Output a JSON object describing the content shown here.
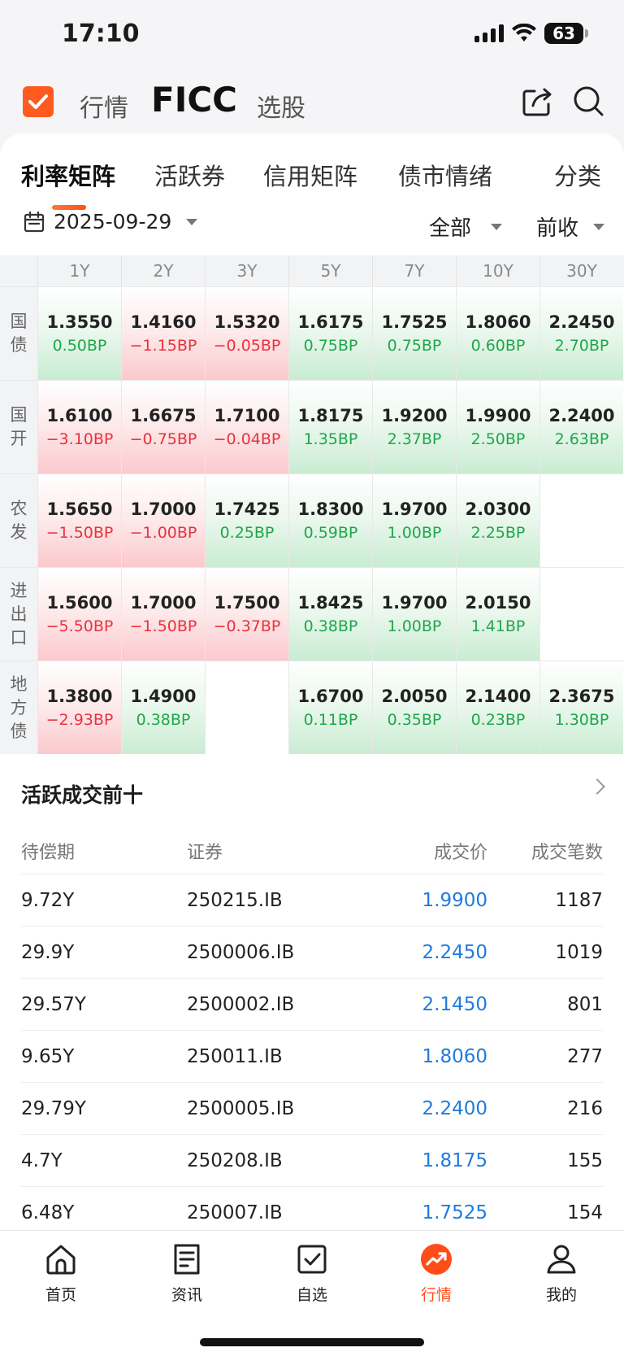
{
  "status": {
    "time": "17:10",
    "battery": "63"
  },
  "header": {
    "tabs": [
      "行情",
      "FICC",
      "选股"
    ],
    "active_tab": "FICC"
  },
  "subtabs": [
    "利率矩阵",
    "活跃券",
    "信用矩阵",
    "债市情绪",
    "分类"
  ],
  "filters": {
    "date": "2025-09-29",
    "scope": "全部",
    "measure": "前收"
  },
  "matrix": {
    "columns": [
      "1Y",
      "2Y",
      "3Y",
      "5Y",
      "7Y",
      "10Y",
      "30Y"
    ],
    "rows": [
      {
        "label": "国债",
        "cells": [
          {
            "v": "1.3550",
            "c": "0.50BP",
            "d": "down"
          },
          {
            "v": "1.4160",
            "c": "−1.15BP",
            "d": "up"
          },
          {
            "v": "1.5320",
            "c": "−0.05BP",
            "d": "up"
          },
          {
            "v": "1.6175",
            "c": "0.75BP",
            "d": "down"
          },
          {
            "v": "1.7525",
            "c": "0.75BP",
            "d": "down"
          },
          {
            "v": "1.8060",
            "c": "0.60BP",
            "d": "down"
          },
          {
            "v": "2.2450",
            "c": "2.70BP",
            "d": "down"
          }
        ]
      },
      {
        "label": "国开",
        "cells": [
          {
            "v": "1.6100",
            "c": "−3.10BP",
            "d": "up"
          },
          {
            "v": "1.6675",
            "c": "−0.75BP",
            "d": "up"
          },
          {
            "v": "1.7100",
            "c": "−0.04BP",
            "d": "up"
          },
          {
            "v": "1.8175",
            "c": "1.35BP",
            "d": "down"
          },
          {
            "v": "1.9200",
            "c": "2.37BP",
            "d": "down"
          },
          {
            "v": "1.9900",
            "c": "2.50BP",
            "d": "down"
          },
          {
            "v": "2.2400",
            "c": "2.63BP",
            "d": "down"
          }
        ]
      },
      {
        "label": "农发",
        "cells": [
          {
            "v": "1.5650",
            "c": "−1.50BP",
            "d": "up"
          },
          {
            "v": "1.7000",
            "c": "−1.00BP",
            "d": "up"
          },
          {
            "v": "1.7425",
            "c": "0.25BP",
            "d": "down"
          },
          {
            "v": "1.8300",
            "c": "0.59BP",
            "d": "down"
          },
          {
            "v": "1.9700",
            "c": "1.00BP",
            "d": "down"
          },
          {
            "v": "2.0300",
            "c": "2.25BP",
            "d": "down"
          },
          {
            "v": "",
            "c": "",
            "d": "empty"
          }
        ]
      },
      {
        "label": "进出口",
        "cells": [
          {
            "v": "1.5600",
            "c": "−5.50BP",
            "d": "up"
          },
          {
            "v": "1.7000",
            "c": "−1.50BP",
            "d": "up"
          },
          {
            "v": "1.7500",
            "c": "−0.37BP",
            "d": "up"
          },
          {
            "v": "1.8425",
            "c": "0.38BP",
            "d": "down"
          },
          {
            "v": "1.9700",
            "c": "1.00BP",
            "d": "down"
          },
          {
            "v": "2.0150",
            "c": "1.41BP",
            "d": "down"
          },
          {
            "v": "",
            "c": "",
            "d": "empty"
          }
        ]
      },
      {
        "label": "地方债",
        "cells": [
          {
            "v": "1.3800",
            "c": "−2.93BP",
            "d": "up"
          },
          {
            "v": "1.4900",
            "c": "0.38BP",
            "d": "down"
          },
          {
            "v": "",
            "c": "",
            "d": "empty"
          },
          {
            "v": "1.6700",
            "c": "0.11BP",
            "d": "down"
          },
          {
            "v": "2.0050",
            "c": "0.35BP",
            "d": "down"
          },
          {
            "v": "2.1400",
            "c": "0.23BP",
            "d": "down"
          },
          {
            "v": "2.3675",
            "c": "1.30BP",
            "d": "down"
          }
        ]
      }
    ]
  },
  "active_trades": {
    "title": "活跃成交前十",
    "headers": [
      "待偿期",
      "证券",
      "成交价",
      "成交笔数"
    ],
    "rows": [
      [
        "9.72Y",
        "250215.IB",
        "1.9900",
        "1187"
      ],
      [
        "29.9Y",
        "2500006.IB",
        "2.2450",
        "1019"
      ],
      [
        "29.57Y",
        "2500002.IB",
        "2.1450",
        "801"
      ],
      [
        "9.65Y",
        "250011.IB",
        "1.8060",
        "277"
      ],
      [
        "29.79Y",
        "2500005.IB",
        "2.2400",
        "216"
      ],
      [
        "4.7Y",
        "250208.IB",
        "1.8175",
        "155"
      ],
      [
        "6.48Y",
        "250007.IB",
        "1.7525",
        "154"
      ]
    ]
  },
  "colors": {
    "accent": "#ff4d1a",
    "up": "#e9323e",
    "down": "#1fa64a",
    "price": "#1f7be0"
  },
  "bottom_nav": [
    {
      "label": "首页",
      "icon": "home-icon"
    },
    {
      "label": "资讯",
      "icon": "news-icon"
    },
    {
      "label": "自选",
      "icon": "watchlist-icon"
    },
    {
      "label": "行情",
      "icon": "market-icon",
      "active": true
    },
    {
      "label": "我的",
      "icon": "profile-icon"
    }
  ]
}
